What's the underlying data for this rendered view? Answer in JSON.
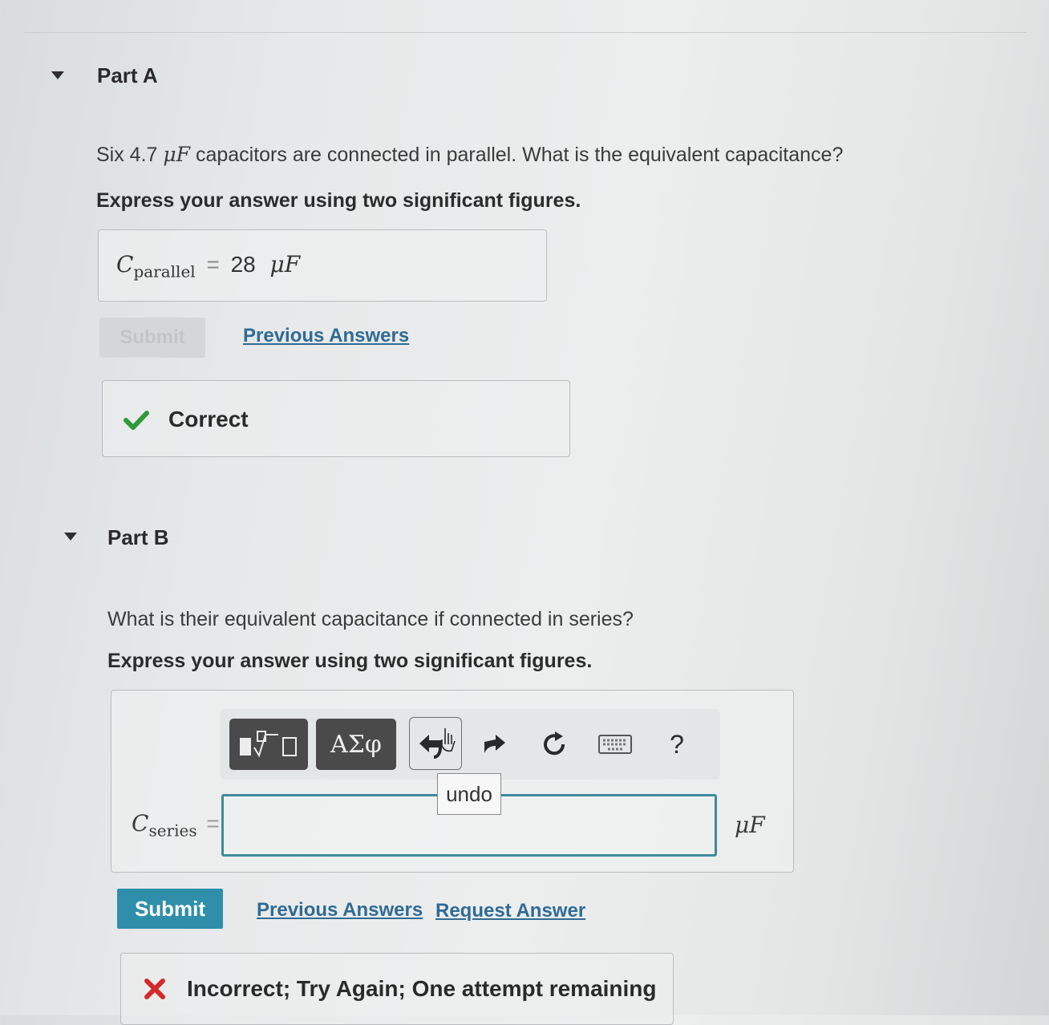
{
  "partA": {
    "title": "Part A",
    "question_pre": "Six 4.7",
    "question_unit": "μF",
    "question_post": "capacitors are connected in parallel. What is the equivalent capacitance?",
    "instruction": "Express your answer using two significant figures.",
    "answer": {
      "symbol": "C",
      "subscript": "parallel",
      "equals": "=",
      "value": "28",
      "unit": "μF"
    },
    "submit_label": "Submit",
    "previous_answers_label": "Previous Answers",
    "feedback": "Correct"
  },
  "partB": {
    "title": "Part B",
    "question": "What is their equivalent capacitance if connected in series?",
    "instruction": "Express your answer using two significant figures.",
    "toolbar": {
      "greek_label": "ΑΣφ",
      "help_label": "?",
      "tooltip": "undo"
    },
    "answer": {
      "symbol": "C",
      "subscript": "series",
      "equals": "=",
      "value": "",
      "unit": "μF"
    },
    "submit_label": "Submit",
    "previous_answers_label": "Previous Answers",
    "request_answer_label": "Request Answer",
    "feedback": "Incorrect; Try Again; One attempt remaining"
  },
  "colors": {
    "submit": "#2f8fab",
    "link": "#2f6b94",
    "correct": "#2e9a3a",
    "incorrect": "#d42a2a",
    "input_border": "#3f8a9a"
  }
}
